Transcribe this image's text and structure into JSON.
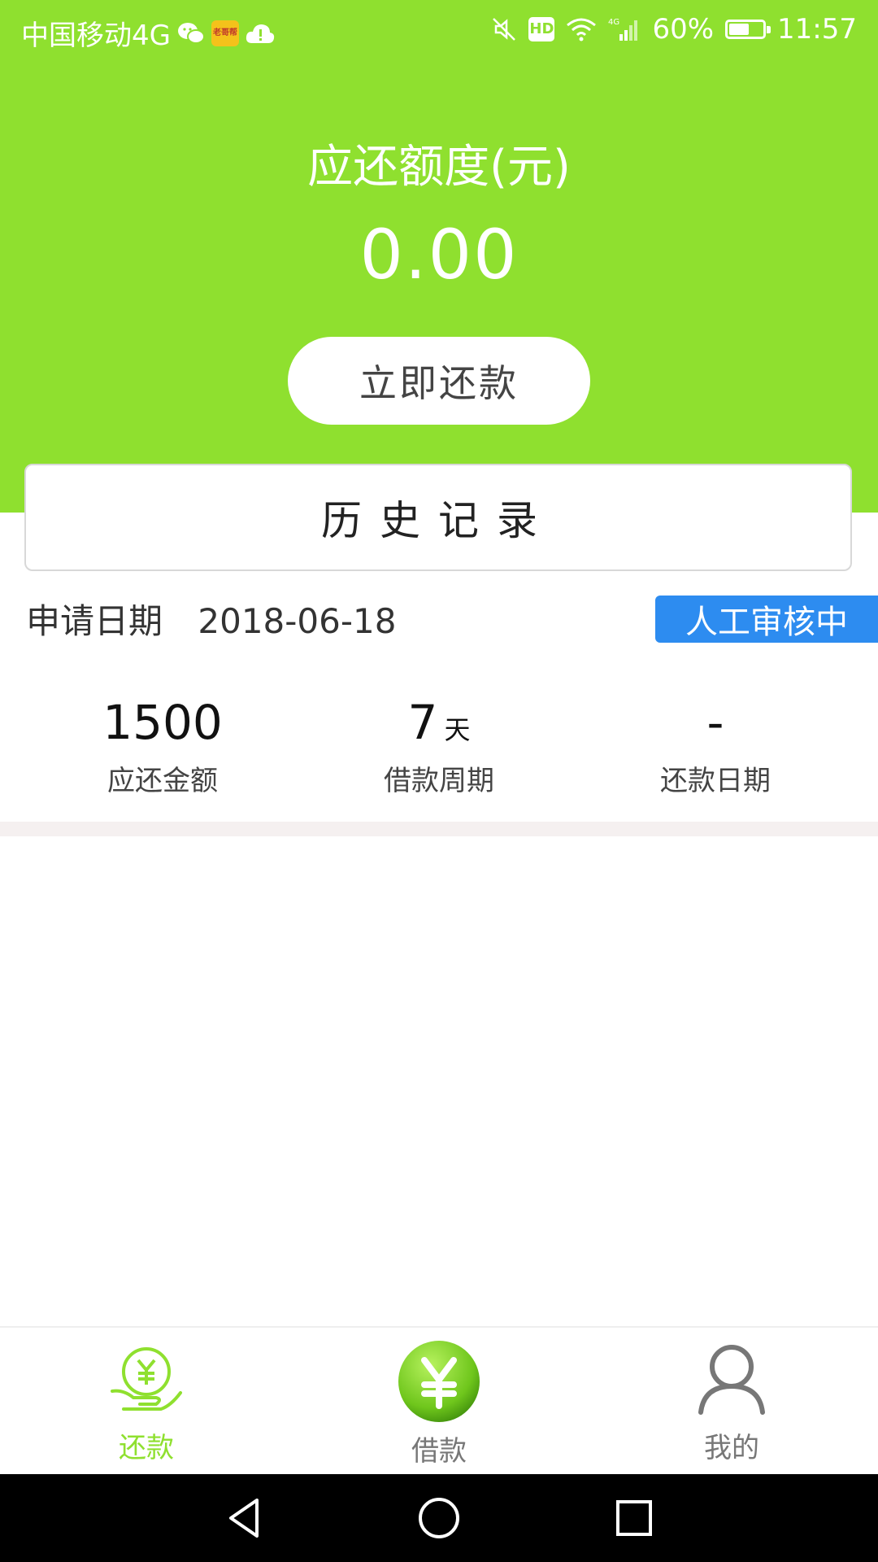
{
  "status_bar": {
    "carrier": "中国移动4G",
    "app_badge": "老哥帮",
    "hd": "HD",
    "network": "4G",
    "battery_level": "60%",
    "battery_fraction": 0.6,
    "time": "11:57",
    "icons": [
      "wechat-icon",
      "app-badge-icon",
      "cloud-alert-icon",
      "mute-icon",
      "hd-icon",
      "wifi-icon",
      "signal-icon",
      "battery-icon"
    ]
  },
  "header": {
    "amount_title": "应还额度(元)",
    "amount_value": "0.00",
    "repay_button": "立即还款"
  },
  "history": {
    "title": "历史记录"
  },
  "record": {
    "date_label": "申请日期",
    "date_value": "2018-06-18",
    "status": "人工审核中",
    "stats": [
      {
        "value": "1500",
        "unit": "",
        "label": "应还金额"
      },
      {
        "value": "7",
        "unit": "天",
        "label": "借款周期"
      },
      {
        "value": "-",
        "unit": "",
        "label": "还款日期"
      }
    ]
  },
  "tabbar": {
    "tabs": [
      {
        "label": "还款",
        "icon": "repay-hand-yen-icon",
        "active": true
      },
      {
        "label": "借款",
        "icon": "yen-circle-icon",
        "active": false
      },
      {
        "label": "我的",
        "icon": "user-icon",
        "active": false
      }
    ]
  },
  "colors": {
    "brand_green": "#8fe02f",
    "badge_blue": "#2d8cf0",
    "tab_active": "#8fe02f",
    "tab_inactive": "#777777"
  }
}
